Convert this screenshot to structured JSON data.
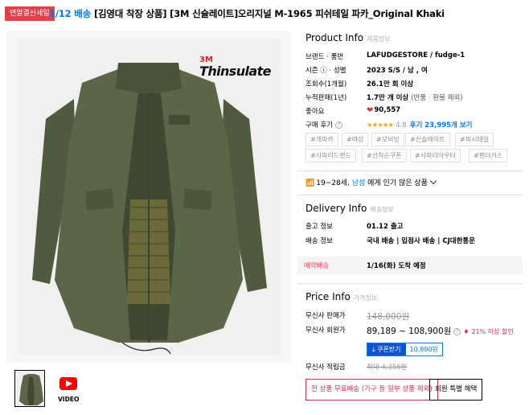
{
  "header": {
    "badge": "연말결산세일",
    "shipping": "1/12 배송",
    "title": "[김영대 착장 상품] [3M 신슐레이트]오리지널 M-1965 피쉬테일 파카_Original Khaki"
  },
  "image": {
    "logo_3m": "3M",
    "logo_text": "Thinsulate"
  },
  "thumbs": {
    "video_label": "VIDEO"
  },
  "product_info": {
    "title": "Product Info",
    "subtitle": "제품정보",
    "rows": [
      {
        "label": "브랜드 · 품번",
        "value": "LAFUDGESTORE  /  fudge-1"
      },
      {
        "label": "시즌 ⓘ · 성별",
        "value": "2023 S/S  /  남 , 여"
      },
      {
        "label": "조회수(1개월)",
        "value": "26.1만 회 이상"
      },
      {
        "label": "누적판매(1년)",
        "value": "1.7만 개 이상",
        "value_note": "(반품 · 환불 제외)"
      },
      {
        "label": "좋아요",
        "value": "90,557"
      }
    ],
    "review": {
      "label": "구매 후기",
      "stars": "★★★★★",
      "score": "4.8",
      "link": "후기 23,995개 보기"
    },
    "tags": [
      "#개파카",
      "#야상",
      "#모비빗",
      "#신슐레이트",
      "#피시테일",
      "#사파리드랜드",
      "#선착순쿠폰",
      "#사파리아우터",
      "#팬더거스"
    ]
  },
  "popular": {
    "prefix": "19~28세",
    "hl": "남성",
    "suffix": "에게 인기 많은 상품"
  },
  "delivery_info": {
    "title": "Delivery Info",
    "subtitle": "배송정보",
    "ship_label": "출고 정보",
    "ship_value": "01.12 출고",
    "method_label": "배송 정보",
    "method_value": "국내 배송  |  입점사 배송  |  CJ대한통운",
    "reserve_label": "예약배송",
    "reserve_value": "1/16(화) 도착 예정"
  },
  "price_info": {
    "title": "Price Info",
    "subtitle": "가격정보",
    "sale_label": "무신사 판매가",
    "sale_value": "148,000원",
    "member_label": "무신사 회원가",
    "member_value": "89,189 ~ 108,900원",
    "discount": "21% 이상 할인",
    "coupon_button": "쿠폰받기",
    "coupon_amount": "10,890원",
    "points_label": "무신사 적립금",
    "points_value": "최대 4,356원"
  },
  "buttons": {
    "free_shipping": "전 상품 무료배송 (가구 등 일부 상품 제외)",
    "member_benefit": "회원 특별 혜택"
  }
}
